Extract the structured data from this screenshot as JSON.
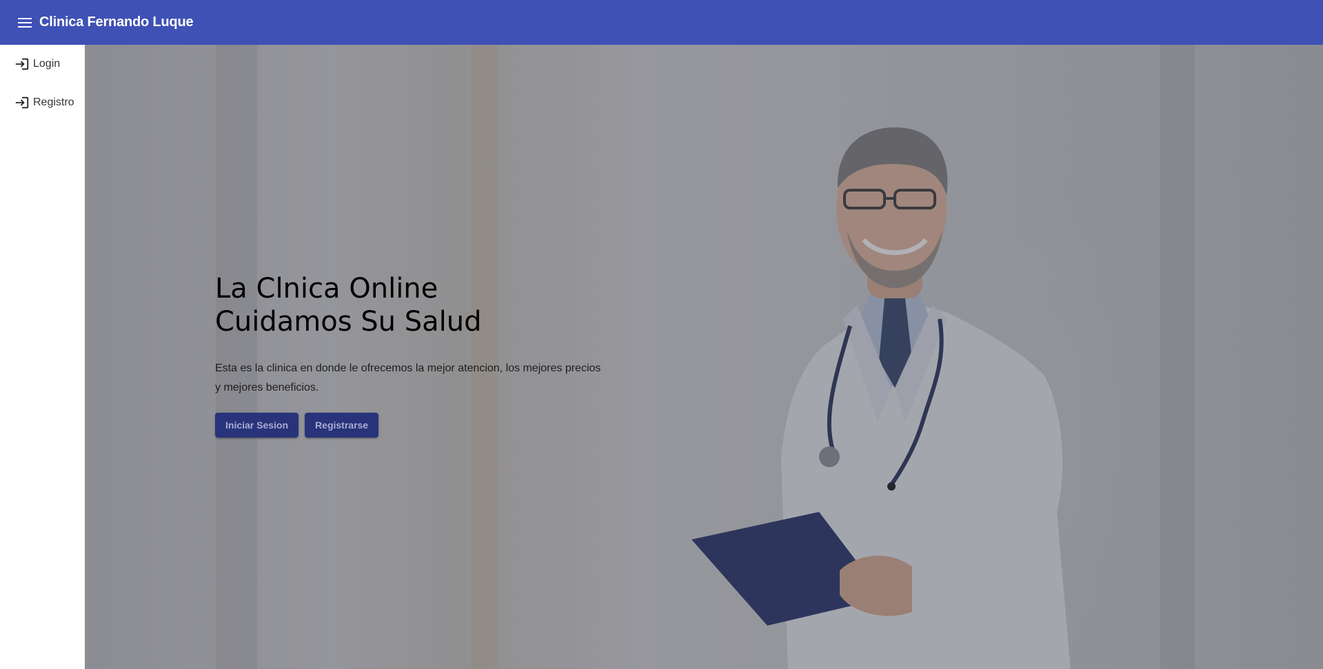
{
  "toolbar": {
    "menu_icon": "menu-icon",
    "title": "Clinica Fernando Luque"
  },
  "sidenav": {
    "items": [
      {
        "label": "Login",
        "icon": "login-icon"
      },
      {
        "label": "Registro",
        "icon": "login-icon"
      }
    ]
  },
  "hero": {
    "title_line1": "La Clnica Online",
    "title_line2": "Cuidamos Su Salud",
    "description": "Esta es la clinica en donde le ofrecemos la mejor atencion, los mejores precios y mejores beneficios.",
    "btn_login": "Iniciar Sesion",
    "btn_register": "Registrarse"
  },
  "colors": {
    "primary": "#3f51b5",
    "button": "#283379",
    "backdrop": "#464650"
  }
}
